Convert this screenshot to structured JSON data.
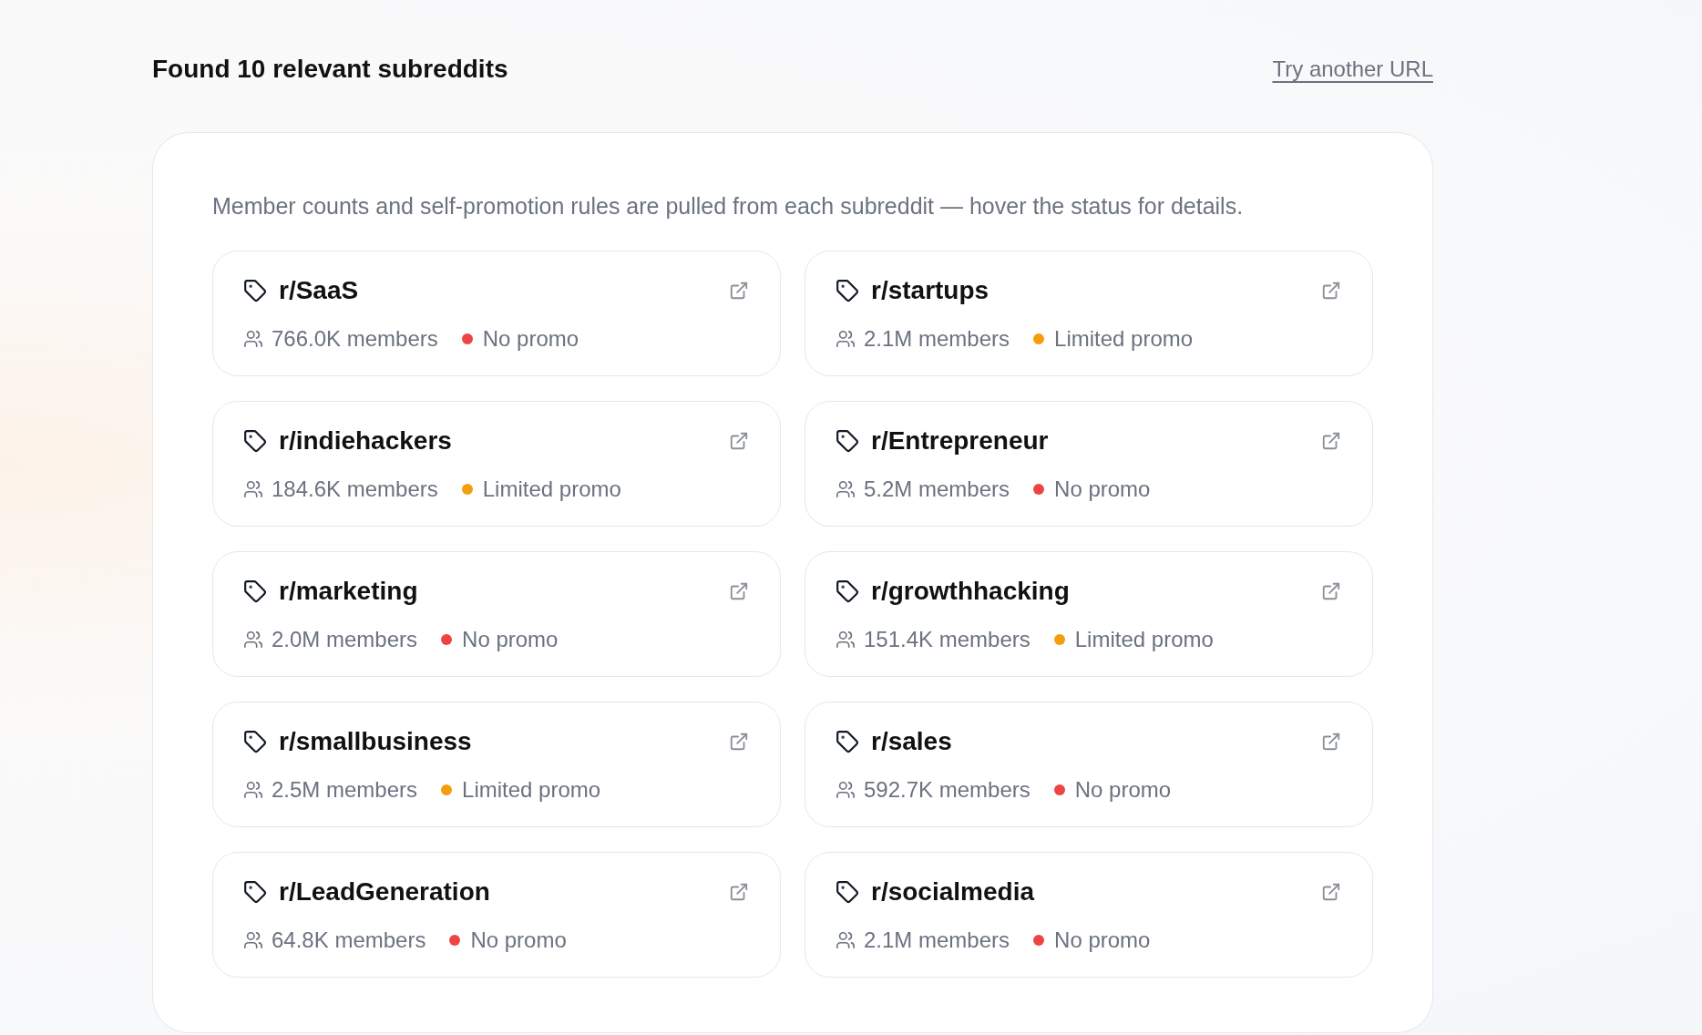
{
  "header": {
    "title": "Found 10 relevant subreddits",
    "link": "Try another URL"
  },
  "panel": {
    "description": "Member counts and self-promotion rules are pulled from each subreddit — hover the status for details.",
    "subreddits": [
      {
        "name": "r/SaaS",
        "members": "766.0K members",
        "status": {
          "label": "No promo",
          "color": "#ef4444"
        }
      },
      {
        "name": "r/startups",
        "members": "2.1M members",
        "status": {
          "label": "Limited promo",
          "color": "#f59e0b"
        }
      },
      {
        "name": "r/indiehackers",
        "members": "184.6K members",
        "status": {
          "label": "Limited promo",
          "color": "#f59e0b"
        }
      },
      {
        "name": "r/Entrepreneur",
        "members": "5.2M members",
        "status": {
          "label": "No promo",
          "color": "#ef4444"
        }
      },
      {
        "name": "r/marketing",
        "members": "2.0M members",
        "status": {
          "label": "No promo",
          "color": "#ef4444"
        }
      },
      {
        "name": "r/growthhacking",
        "members": "151.4K members",
        "status": {
          "label": "Limited promo",
          "color": "#f59e0b"
        }
      },
      {
        "name": "r/smallbusiness",
        "members": "2.5M members",
        "status": {
          "label": "Limited promo",
          "color": "#f59e0b"
        }
      },
      {
        "name": "r/sales",
        "members": "592.7K members",
        "status": {
          "label": "No promo",
          "color": "#ef4444"
        }
      },
      {
        "name": "r/LeadGeneration",
        "members": "64.8K members",
        "status": {
          "label": "No promo",
          "color": "#ef4444"
        }
      },
      {
        "name": "r/socialmedia",
        "members": "2.1M members",
        "status": {
          "label": "No promo",
          "color": "#ef4444"
        }
      }
    ]
  }
}
